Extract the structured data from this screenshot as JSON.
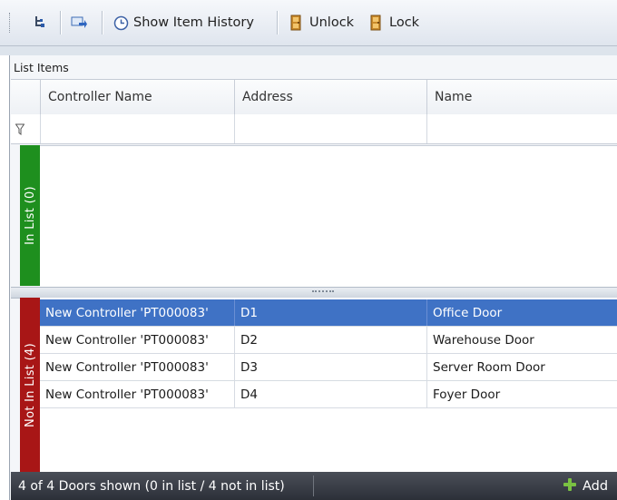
{
  "toolbar": {
    "show_history_label": "Show Item History",
    "unlock_label": "Unlock",
    "lock_label": "Lock"
  },
  "panel": {
    "title": "List Items"
  },
  "columns": [
    "Controller Name",
    "Address",
    "Name"
  ],
  "groups": {
    "in_list_label": "In List (0)",
    "not_in_list_label": "Not In List (4)"
  },
  "rows": [
    {
      "controller": "New Controller 'PT000083'",
      "address": "D1",
      "name": "Office Door",
      "selected": true
    },
    {
      "controller": "New Controller 'PT000083'",
      "address": "D2",
      "name": "Warehouse Door",
      "selected": false
    },
    {
      "controller": "New Controller 'PT000083'",
      "address": "D3",
      "name": "Server Room Door",
      "selected": false
    },
    {
      "controller": "New Controller 'PT000083'",
      "address": "D4",
      "name": "Foyer Door",
      "selected": false
    }
  ],
  "status": {
    "summary": "4 of 4 Doors shown (0 in list / 4 not in list)",
    "add_label": "Add"
  },
  "colors": {
    "in_list_bar": "#1e8f1e",
    "not_in_list_bar": "#a81616",
    "selection": "#3f72c5"
  }
}
